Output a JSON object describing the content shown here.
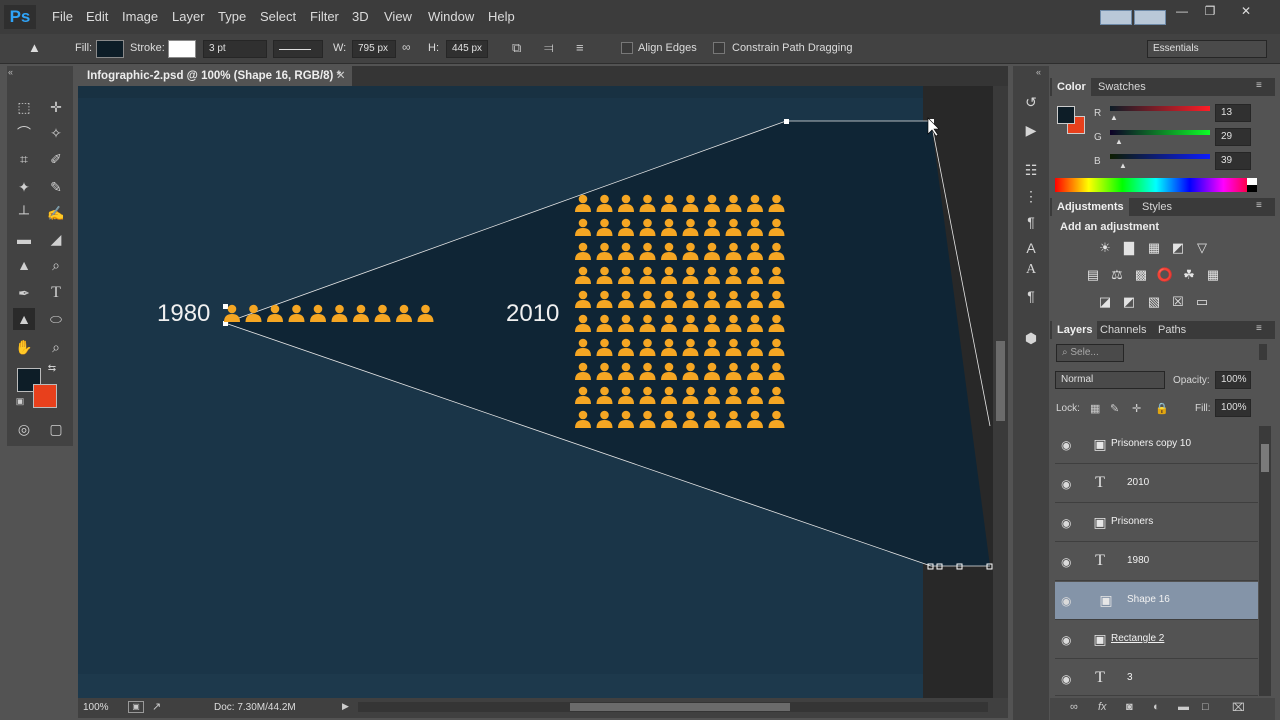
{
  "app": {
    "logo": "Ps",
    "menu": [
      "File",
      "Edit",
      "Image",
      "Layer",
      "Type",
      "Select",
      "Filter",
      "3D",
      "View",
      "Window",
      "Help"
    ],
    "window_controls": [
      "minimize-icon",
      "restore-icon",
      "close-icon"
    ]
  },
  "options": {
    "fill_label": "Fill:",
    "stroke_label": "Stroke:",
    "stroke_width": "3 pt",
    "w_label": "W:",
    "w_value": "795 px",
    "h_label": "H:",
    "h_value": "445 px",
    "align_edges": "Align Edges",
    "constrain_path": "Constrain Path Dragging",
    "workspace": "Essentials",
    "colors": {
      "fill": "#0d1d27",
      "stroke": "#ffffff"
    }
  },
  "document": {
    "tab_title": "Infographic-2.psd @ 100% (Shape 16, RGB/8) *",
    "zoom": "100%",
    "doc_info": "Doc: 7.30M/44.2M",
    "artwork": {
      "year_left": "1980",
      "year_right": "2010",
      "people_1980": 10,
      "people_2010": {
        "rows": 10,
        "cols": 10
      },
      "background": "#1a3548",
      "shape_color": "#0f2535",
      "person_color": "#f5a623"
    }
  },
  "color_panel": {
    "tabs": [
      "Color",
      "Swatches"
    ],
    "r_label": "R",
    "r_value": "13",
    "g_label": "G",
    "g_value": "29",
    "b_label": "B",
    "b_value": "39",
    "fg": "#0d1d27",
    "bg": "#e8401c"
  },
  "adjustments_panel": {
    "tabs": [
      "Adjustments",
      "Styles"
    ],
    "heading": "Add an adjustment"
  },
  "layers_panel": {
    "tabs": [
      "Layers",
      "Channels",
      "Paths"
    ],
    "filter_placeholder": "Sele...",
    "blend_mode": "Normal",
    "opacity_label": "Opacity:",
    "opacity": "100%",
    "lock_label": "Lock:",
    "fill_label": "Fill:",
    "fill": "100%",
    "layers": [
      {
        "name": "Prisoners copy 10",
        "type": "shape",
        "selected": false
      },
      {
        "name": "2010",
        "type": "text",
        "selected": false
      },
      {
        "name": "Prisoners",
        "type": "shape",
        "selected": false
      },
      {
        "name": "1980",
        "type": "text",
        "selected": false
      },
      {
        "name": "Shape 16",
        "type": "shape",
        "selected": true
      },
      {
        "name": "Rectangle 2",
        "type": "shape",
        "selected": false
      },
      {
        "name": "3",
        "type": "text",
        "selected": false
      }
    ]
  }
}
